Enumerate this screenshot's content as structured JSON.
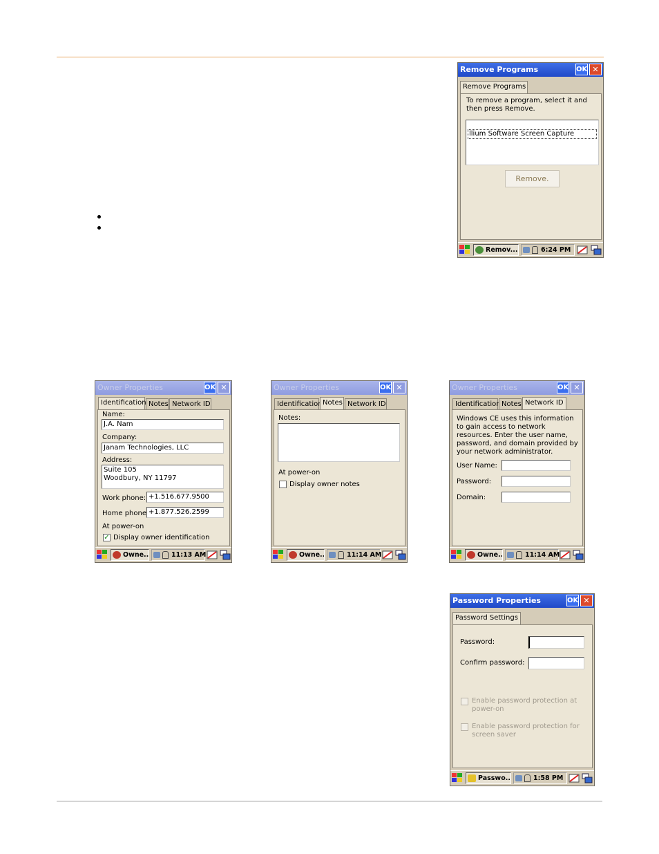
{
  "remove_programs": {
    "title": "Remove Programs",
    "ok": "OK",
    "close": "✕",
    "tab": "Remove Programs",
    "instruction": "To remove a program, select it and then press Remove.",
    "list_item": "llium Software Screen Capture",
    "remove_button": "Remove.",
    "taskbar_task": "Remov...",
    "clock": "6:24 PM"
  },
  "owner_identification": {
    "title": "Owner Properties",
    "ok": "OK",
    "close": "✕",
    "tabs": [
      "Identification",
      "Notes",
      "Network ID"
    ],
    "name_label": "Name:",
    "name_value": "J.A. Nam",
    "company_label": "Company:",
    "company_value": "Janam Technologies, LLC",
    "address_label": "Address:",
    "address_value": "Suite 105\nWoodbury, NY 11797",
    "work_phone_label": "Work phone:",
    "work_phone_value": "+1.516.677.9500",
    "home_phone_label": "Home phone:",
    "home_phone_value": "+1.877.526.2599",
    "at_power_on": "At power-on",
    "display_checkbox": "Display owner identification",
    "taskbar_task": "Owne...",
    "clock": "11:13 AM"
  },
  "owner_notes": {
    "title": "Owner Properties",
    "ok": "OK",
    "close": "✕",
    "tabs": [
      "Identification",
      "Notes",
      "Network ID"
    ],
    "notes_label": "Notes:",
    "at_power_on": "At power-on",
    "display_checkbox": "Display owner notes",
    "taskbar_task": "Owne...",
    "clock": "11:14 AM"
  },
  "owner_network": {
    "title": "Owner Properties",
    "ok": "OK",
    "close": "✕",
    "tabs": [
      "Identification",
      "Notes",
      "Network ID"
    ],
    "description": "Windows CE uses this information to gain access to network resources. Enter the user name, password, and domain provided by your network administrator.",
    "user_name_label": "User Name:",
    "password_label": "Password:",
    "domain_label": "Domain:",
    "taskbar_task": "Owne...",
    "clock": "11:14 AM"
  },
  "password_properties": {
    "title": "Password Properties",
    "ok": "OK",
    "close": "✕",
    "tab": "Password Settings",
    "password_label": "Password:",
    "confirm_label": "Confirm password:",
    "enable_power_on": "Enable password protection at power-on",
    "enable_screen_saver": "Enable password protection for screen saver",
    "taskbar_task": "Passwo...",
    "clock": "1:58 PM"
  }
}
